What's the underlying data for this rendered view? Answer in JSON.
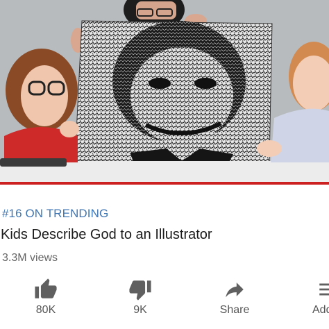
{
  "video": {
    "progress_fraction": 1.0,
    "progress_color": "#cc1f1f"
  },
  "trending_badge": "#16 ON TRENDING",
  "video_title": "Kids Describe God to an Illustrator",
  "view_count": "3.3M views",
  "actions": [
    {
      "icon": "thumbs-up-icon",
      "label": "80K"
    },
    {
      "icon": "thumbs-down-icon",
      "label": "9K"
    },
    {
      "icon": "share-icon",
      "label": "Share"
    },
    {
      "icon": "add-to-playlist-icon",
      "label": "Add"
    }
  ],
  "colors": {
    "trending_blue": "#3f76b4",
    "icon_gray": "#606060"
  }
}
